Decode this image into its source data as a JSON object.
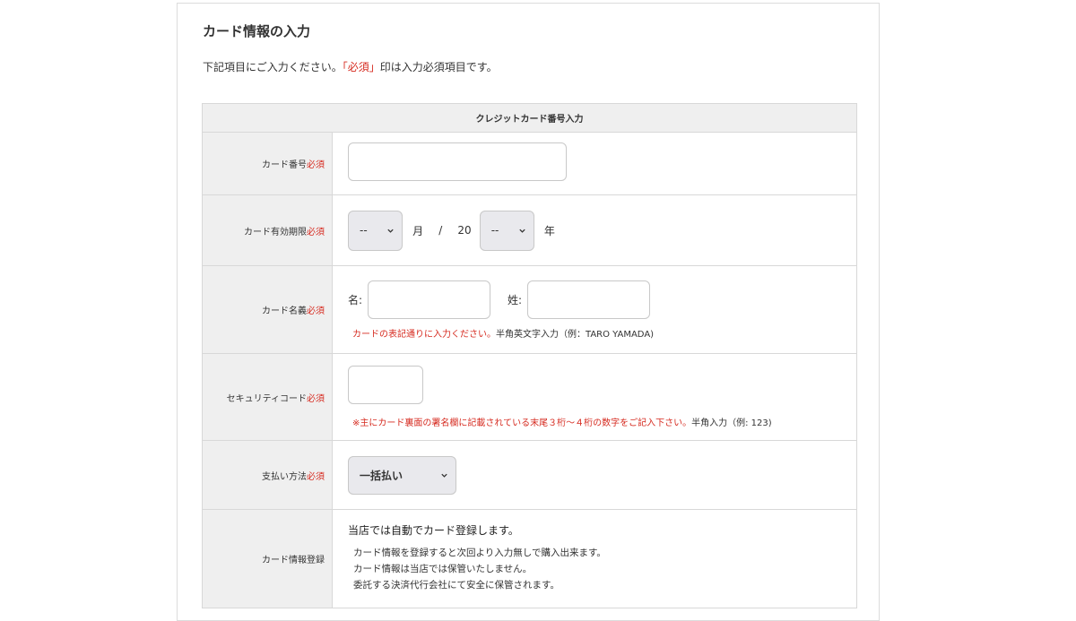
{
  "form": {
    "title": "カード情報の入力",
    "intro_prefix": "下記項目にご入力ください。",
    "intro_required": "「必須」",
    "intro_suffix": "印は入力必須項目です。",
    "section_header": "クレジットカード番号入力",
    "required_mark": "必須",
    "fields": {
      "card_number": {
        "label": "カード番号",
        "value": ""
      },
      "expiry": {
        "label": "カード有効期限",
        "month_value": "--",
        "month_unit": "月",
        "separator": "/",
        "year_prefix": "20",
        "year_value": "--",
        "year_unit": "年"
      },
      "card_name": {
        "label": "カード名義",
        "first_label": "名:",
        "last_label": "姓:",
        "first_value": "",
        "last_value": "",
        "note_red": "カードの表記通りに入力ください。",
        "note_black": "半角英文字入力（例：TARO YAMADA)"
      },
      "security_code": {
        "label": "セキュリティコード",
        "value": "",
        "note_red": "※主にカード裏面の署名欄に記載されている末尾３桁～４桁の数字をご記入下さい。",
        "note_black": "半角入力（例: 123)"
      },
      "payment_method": {
        "label": "支払い方法",
        "selected": "一括払い"
      },
      "card_registration": {
        "label": "カード情報登録",
        "heading": "当店では自動でカード登録します。",
        "lines": [
          "カード情報を登録すると次回より入力無しで購入出来ます。",
          "カード情報は当店では保管いたしません。",
          "委託する決済代行会社にて安全に保管されます。"
        ]
      }
    }
  },
  "colors": {
    "required_red": "#d62b20",
    "label_bg": "#efefef",
    "select_bg": "#e9e9ed"
  },
  "icons": {
    "select_arrow": "chevron-down-icon"
  }
}
